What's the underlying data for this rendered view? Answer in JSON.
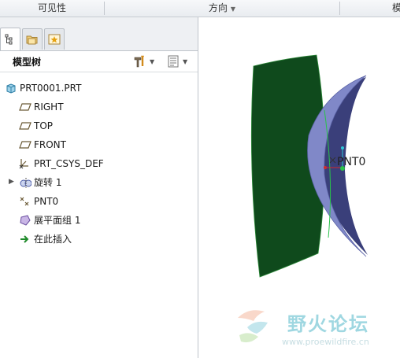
{
  "toolbar": {
    "groups": [
      "可见性",
      "方向",
      "模"
    ]
  },
  "panel": {
    "title": "模型树"
  },
  "tree": {
    "root": "PRT0001.PRT",
    "items": [
      {
        "label": "RIGHT",
        "icon": "datum-plane-icon"
      },
      {
        "label": "TOP",
        "icon": "datum-plane-icon"
      },
      {
        "label": "FRONT",
        "icon": "datum-plane-icon"
      },
      {
        "label": "PRT_CSYS_DEF",
        "icon": "csys-icon"
      },
      {
        "label": "旋转 1",
        "icon": "revolve-icon"
      },
      {
        "label": "PNT0",
        "icon": "datum-point-icon"
      },
      {
        "label": "展平面组 1",
        "icon": "flatten-quilt-icon"
      },
      {
        "label": "在此插入",
        "icon": "insert-here-arrow-icon"
      }
    ]
  },
  "viewport": {
    "point_label": "PNT0",
    "colors": {
      "flat_quilt": "#0f4a1c",
      "revolve_surface": "#8088c8",
      "revolve_shadow": "#3a3f7a"
    }
  },
  "watermark": {
    "text": "野火论坛",
    "url": "www.proewildfire.cn"
  }
}
